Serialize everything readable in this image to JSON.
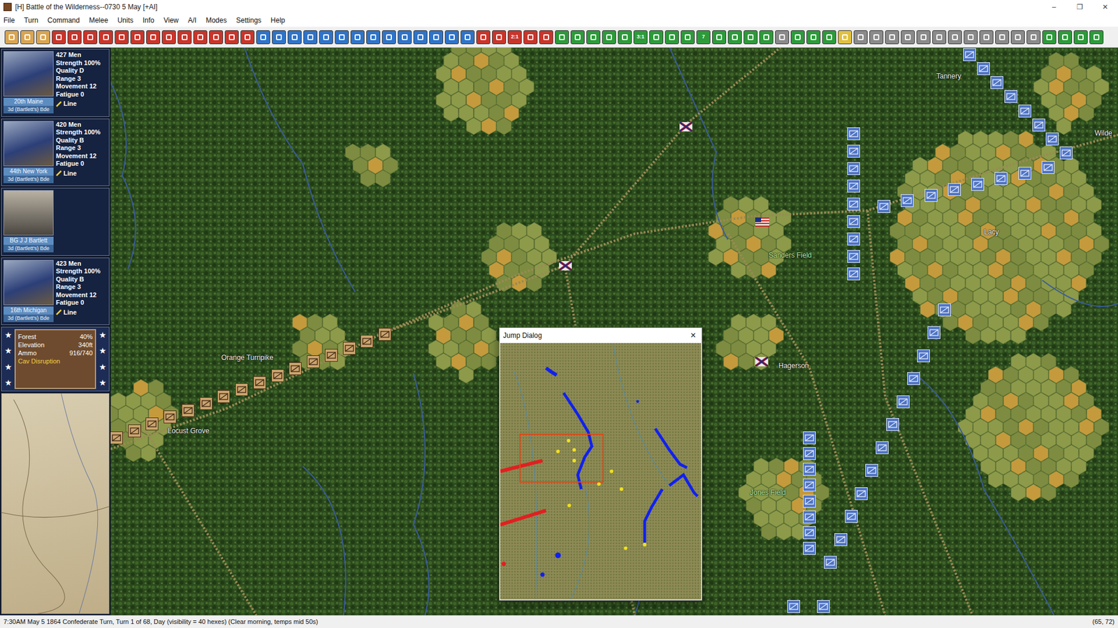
{
  "window": {
    "title": "[H] Battle of the Wilderness--0730 5 May [+AI]",
    "controls": [
      "–",
      "❐",
      "✕"
    ]
  },
  "menu": [
    "File",
    "Turn",
    "Command",
    "Melee",
    "Units",
    "Info",
    "View",
    "A/I",
    "Modes",
    "Settings",
    "Help"
  ],
  "toolbar": [
    {
      "kind": "tan",
      "buttons": [
        "",
        "",
        ""
      ]
    },
    {
      "kind": "red",
      "buttons": [
        "",
        "",
        "",
        "",
        "",
        "",
        "",
        "",
        "",
        "",
        "",
        "",
        ""
      ]
    },
    {
      "kind": "blue",
      "buttons": [
        "",
        "",
        "",
        "",
        "",
        "",
        "",
        "",
        "",
        "",
        "",
        "",
        "",
        ""
      ]
    },
    {
      "kind": "red",
      "buttons": [
        "",
        "",
        "2:1",
        "",
        ""
      ]
    },
    {
      "kind": "green",
      "buttons": [
        "",
        "",
        "",
        "",
        "",
        "3:1",
        "",
        "",
        "",
        "7",
        "",
        "",
        "",
        ""
      ]
    },
    {
      "kind": "grey",
      "buttons": [
        ""
      ]
    },
    {
      "kind": "green",
      "buttons": [
        "",
        "",
        ""
      ]
    },
    {
      "kind": "yellow",
      "buttons": [
        ""
      ]
    },
    {
      "kind": "grey",
      "buttons": [
        "",
        "",
        "",
        "",
        "",
        "",
        "",
        "",
        "",
        "",
        "",
        ""
      ]
    },
    {
      "kind": "green",
      "buttons": [
        "",
        "",
        "",
        ""
      ]
    }
  ],
  "units": [
    {
      "kind": "regiment",
      "name": "20th Maine",
      "brigade": "3d (Bartlett's) Bde",
      "men": "427 Men",
      "strength": "Strength 100%",
      "quality": "Quality D",
      "range": "Range 3",
      "movement": "Movement 12",
      "fatigue": "Fatigue 0",
      "formation": "Line"
    },
    {
      "kind": "regiment",
      "name": "44th New York",
      "brigade": "3d (Bartlett's) Bde",
      "men": "420 Men",
      "strength": "Strength 100%",
      "quality": "Quality B",
      "range": "Range 3",
      "movement": "Movement 12",
      "fatigue": "Fatigue 0",
      "formation": "Line"
    },
    {
      "kind": "leader",
      "name": "BG J J Bartlett",
      "brigade": "3d (Bartlett's) Bde",
      "men": "",
      "strength": "",
      "quality": "",
      "range": "",
      "movement": "",
      "fatigue": "",
      "formation": ""
    },
    {
      "kind": "regiment",
      "name": "16th Michigan",
      "brigade": "3d (Bartlett's) Bde",
      "men": "423 Men",
      "strength": "Strength 100%",
      "quality": "Quality B",
      "range": "Range 3",
      "movement": "Movement 12",
      "fatigue": "Fatigue 0",
      "formation": "Line"
    }
  ],
  "terrain": {
    "star": "★",
    "lines": [
      {
        "label": "Forest",
        "value": "40%"
      },
      {
        "label": "Elevation",
        "value": "340ft"
      },
      {
        "label": "Ammo",
        "value": "916/740"
      }
    ],
    "alert": "Cav Disruption"
  },
  "map": {
    "labels": [
      {
        "text": "Tannery",
        "color": "#f2f2f2"
      },
      {
        "text": "Wilde",
        "color": "#f2f2f2"
      },
      {
        "text": "Lacy",
        "color": "#f2f2f2"
      },
      {
        "text": "Sanders Field",
        "color": "#b6f0a8"
      },
      {
        "text": "Hagerson",
        "color": "#f2f2f2"
      },
      {
        "text": "Jones Field",
        "color": "#b6f0a8"
      },
      {
        "text": "Orange Turnpike",
        "color": "#f2f2f2"
      },
      {
        "text": "Locust Grove",
        "color": "#f2f2f2"
      }
    ],
    "counter_groups": [
      {
        "kind": "confederate",
        "count": 16
      },
      {
        "kind": "union",
        "count": 9
      },
      {
        "kind": "union",
        "count": 8
      },
      {
        "kind": "union",
        "count": 8
      },
      {
        "kind": "union",
        "count": 12
      },
      {
        "kind": "union",
        "count": 8
      },
      {
        "kind": "union",
        "count": 2
      },
      {
        "kind": "marker",
        "count": 3
      },
      {
        "kind": "flag",
        "count": 1
      }
    ]
  },
  "jump_dialog": {
    "title": "Jump Dialog",
    "close": "×"
  },
  "status_bar": {
    "text": "7:30AM May 5 1864 Confederate Turn, Turn 1 of 68, Day (visibility = 40 hexes) (Clear morning, temps mid 50s)",
    "coords": "(65, 72)"
  }
}
